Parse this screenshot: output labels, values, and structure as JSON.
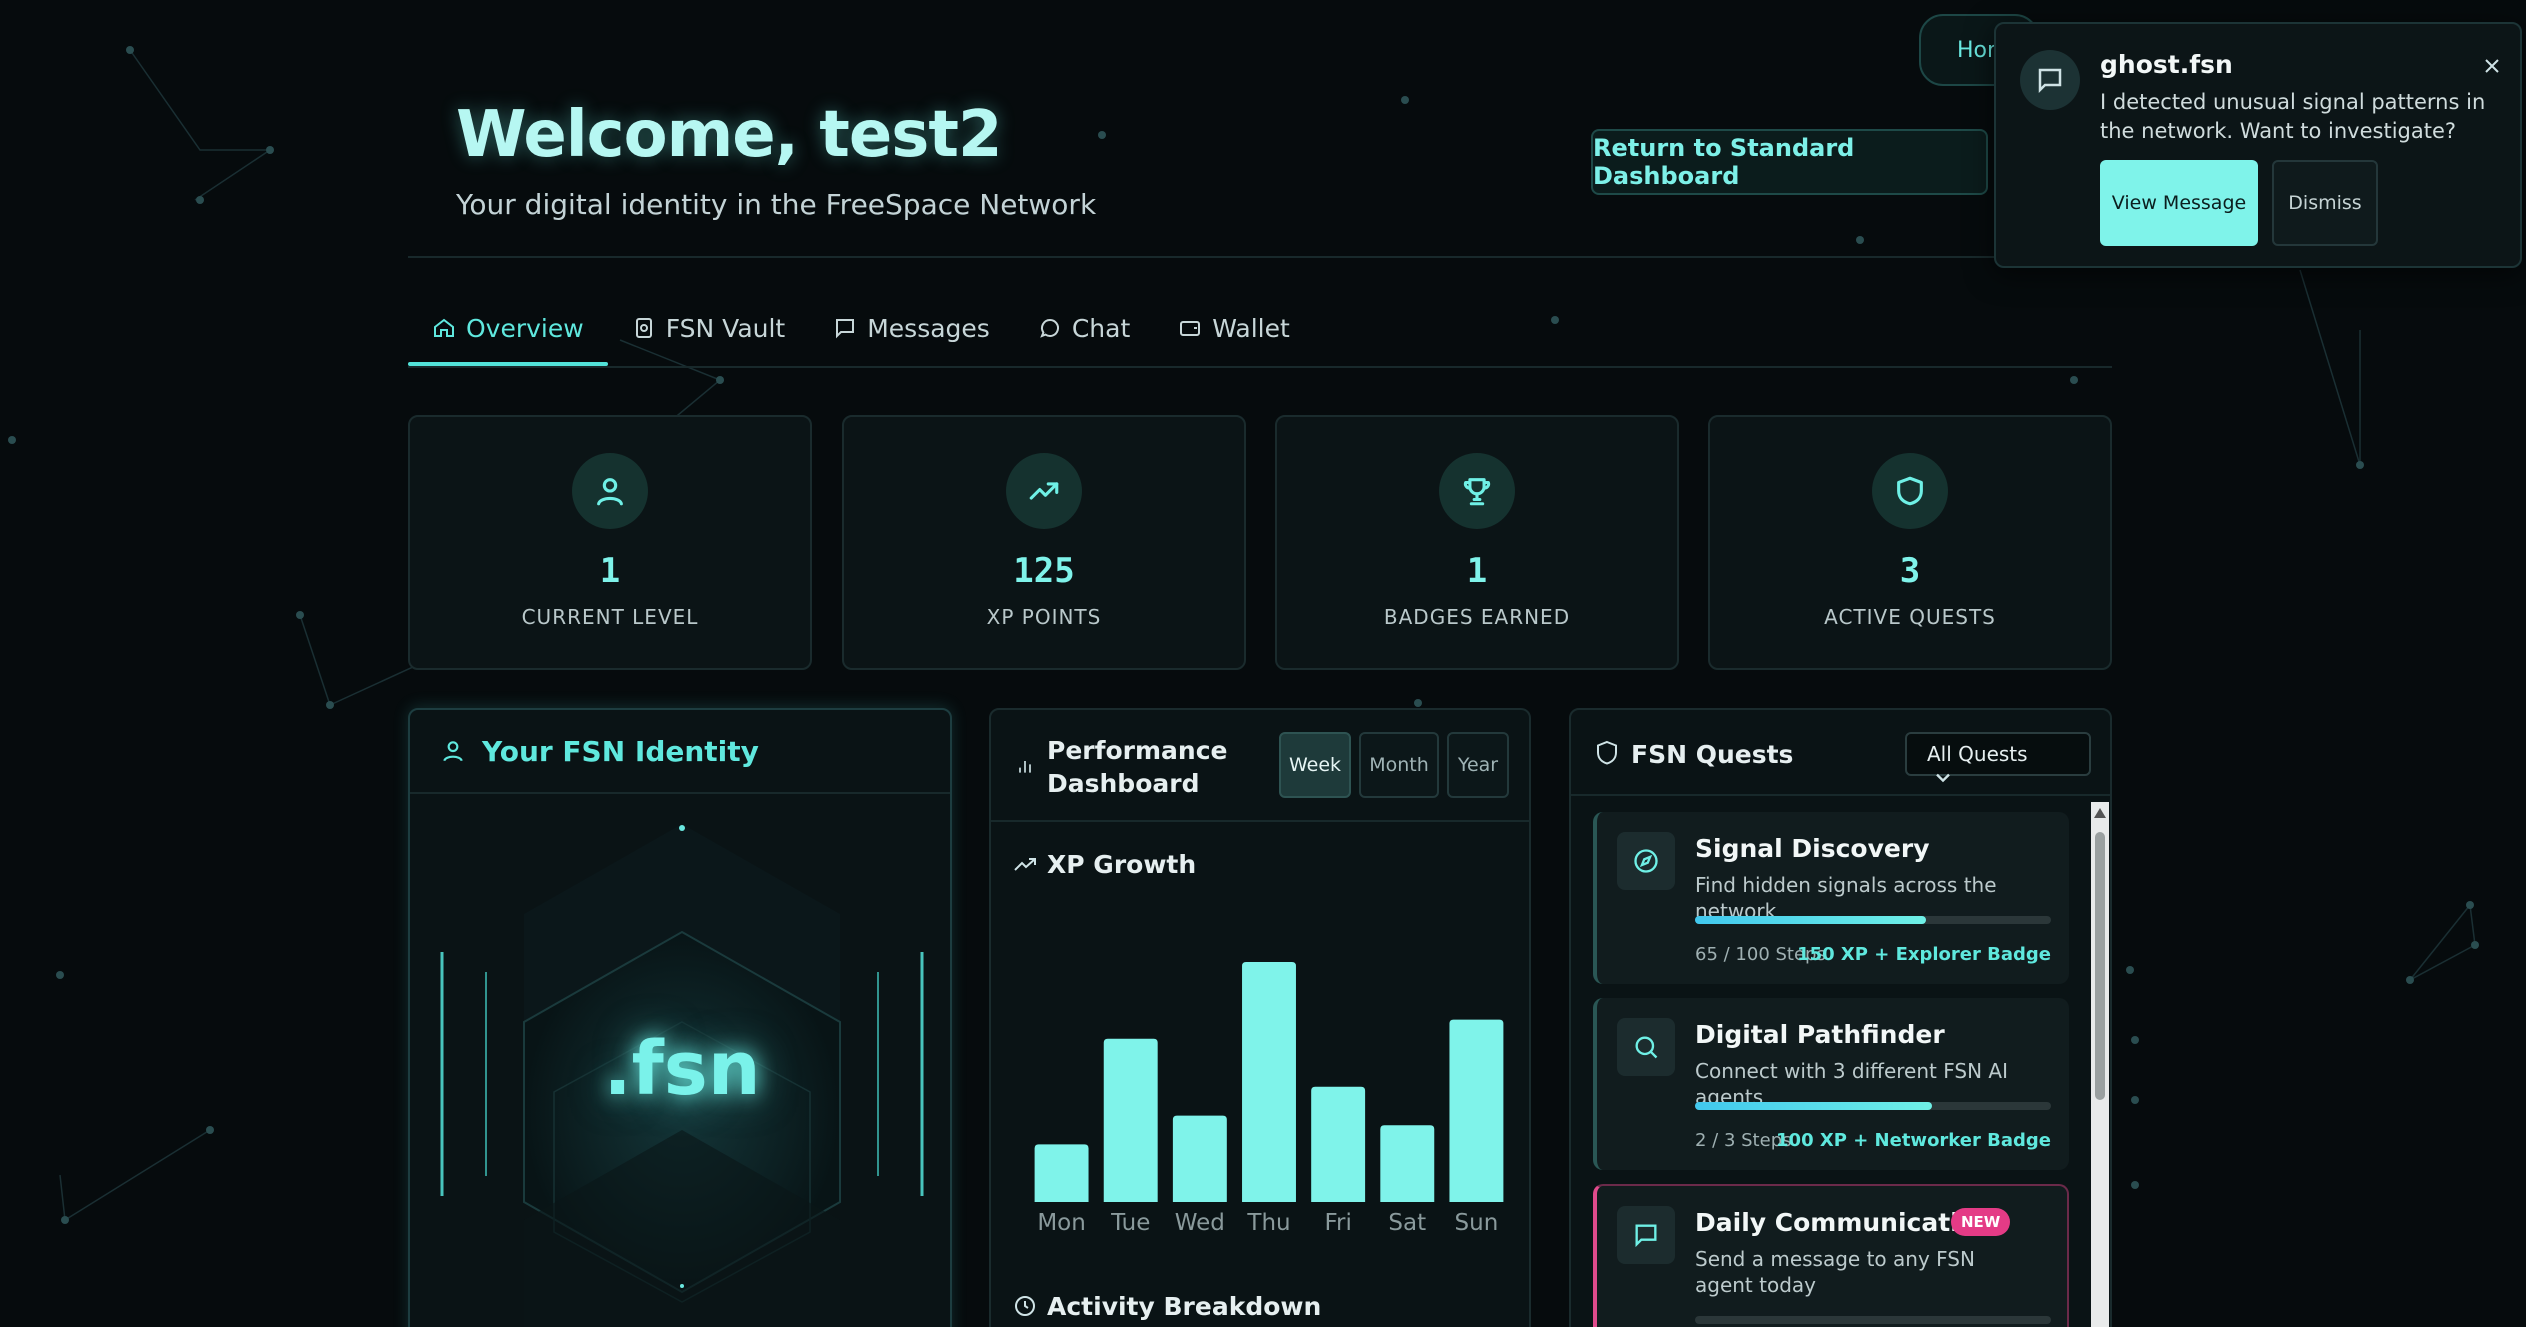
{
  "header": {
    "welcome": "Welcome, test2",
    "subtitle": "Your digital identity in the FreeSpace Network",
    "return_button": "Return to Standard Dashboard",
    "home_pill": "Hon"
  },
  "tabs": [
    {
      "label": "Overview",
      "icon": "home-icon",
      "active": true
    },
    {
      "label": "FSN Vault",
      "icon": "vault-icon"
    },
    {
      "label": "Messages",
      "icon": "message-square-icon"
    },
    {
      "label": "Chat",
      "icon": "chat-bubble-icon"
    },
    {
      "label": "Wallet",
      "icon": "wallet-icon"
    }
  ],
  "stats": [
    {
      "value": "1",
      "label": "CURRENT LEVEL",
      "icon": "user-icon"
    },
    {
      "value": "125",
      "label": "XP POINTS",
      "icon": "trending-up-icon"
    },
    {
      "value": "1",
      "label": "BADGES EARNED",
      "icon": "trophy-icon"
    },
    {
      "value": "3",
      "label": "ACTIVE QUESTS",
      "icon": "shield-icon"
    }
  ],
  "identity": {
    "title": "Your FSN Identity",
    "domain": ".fsn"
  },
  "performance": {
    "title": "Performance Dashboard",
    "ranges": [
      "Week",
      "Month",
      "Year"
    ],
    "active_range": "Week",
    "xp_title": "XP Growth",
    "activity_title": "Activity Breakdown"
  },
  "chart_data": {
    "type": "bar",
    "categories": [
      "Mon",
      "Tue",
      "Wed",
      "Thu",
      "Fri",
      "Sat",
      "Sun"
    ],
    "values": [
      24,
      68,
      36,
      100,
      48,
      32,
      76
    ],
    "title": "XP Growth",
    "xlabel": "",
    "ylabel": "",
    "ylim": [
      0,
      100
    ],
    "grid": false,
    "bar_color": "#7ff3ea"
  },
  "quests": {
    "title": "FSN Quests",
    "filter": "All Quests",
    "items": [
      {
        "title": "Signal Discovery",
        "description": "Find hidden signals across the network",
        "steps": "65 / 100 Steps",
        "progress": 0.65,
        "reward": "150 XP + Explorer Badge",
        "icon": "compass-icon"
      },
      {
        "title": "Digital Pathfinder",
        "description": "Connect with 3 different FSN AI agents",
        "steps": "2 / 3 Steps",
        "progress": 0.667,
        "reward": "100 XP + Networker Badge",
        "icon": "search-icon"
      },
      {
        "title": "Daily Communication",
        "description": "Send a message to any FSN agent today",
        "badge": "NEW",
        "progress": 0,
        "icon": "message-square-icon"
      }
    ]
  },
  "notification": {
    "from": "ghost.fsn",
    "message": "I detected unusual signal patterns in the network. Want to investigate?",
    "view_label": "View Message",
    "dismiss_label": "Dismiss"
  },
  "colors": {
    "accent": "#7ff3ea",
    "background": "#060b0d",
    "badge_new": "#e43b86"
  }
}
